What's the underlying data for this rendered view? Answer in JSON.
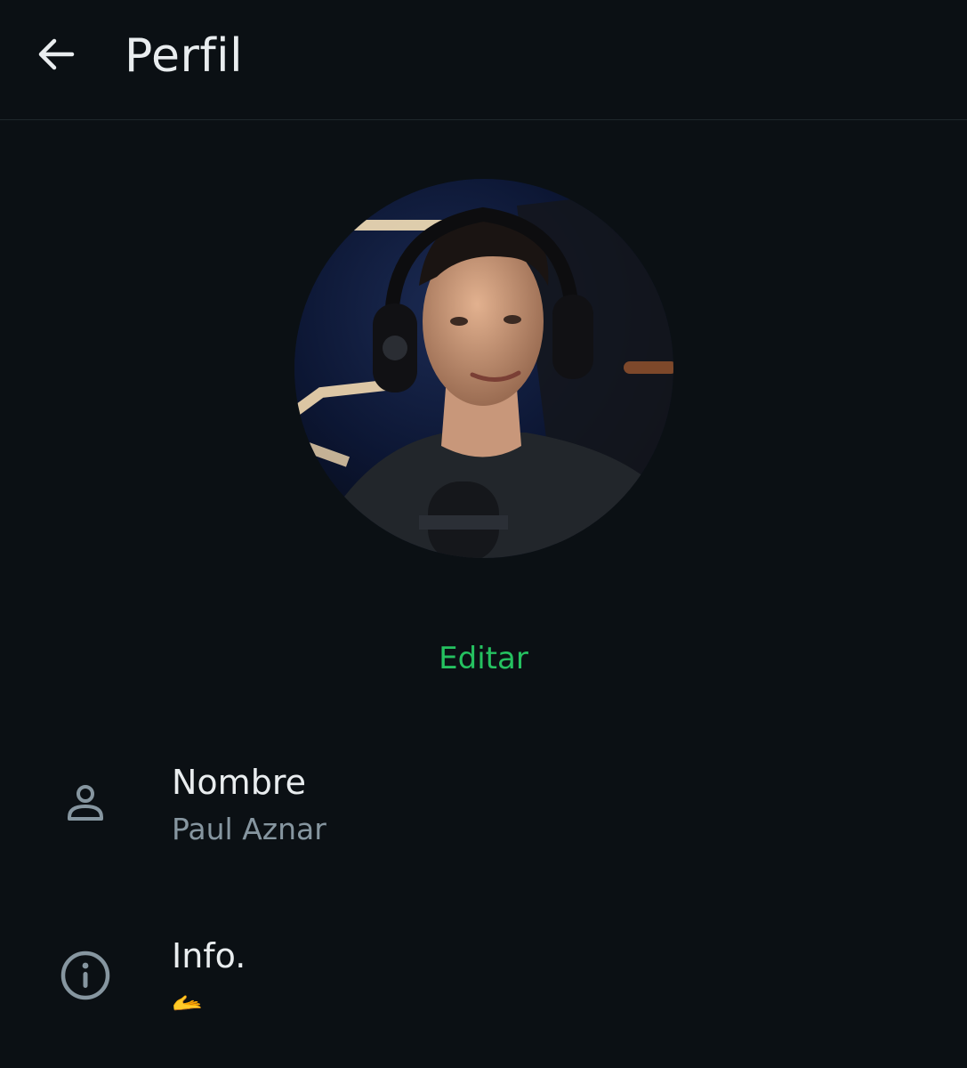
{
  "header": {
    "back_icon": "arrow-left-icon",
    "title": "Perfil"
  },
  "profile": {
    "avatar_icon": "profile-photo",
    "edit_label": "Editar",
    "accent_color": "#25c160"
  },
  "fields": {
    "name": {
      "icon": "person-icon",
      "label": "Nombre",
      "value": "Paul Aznar"
    },
    "info": {
      "icon": "info-icon",
      "label": "Info.",
      "value": "🫴"
    }
  }
}
